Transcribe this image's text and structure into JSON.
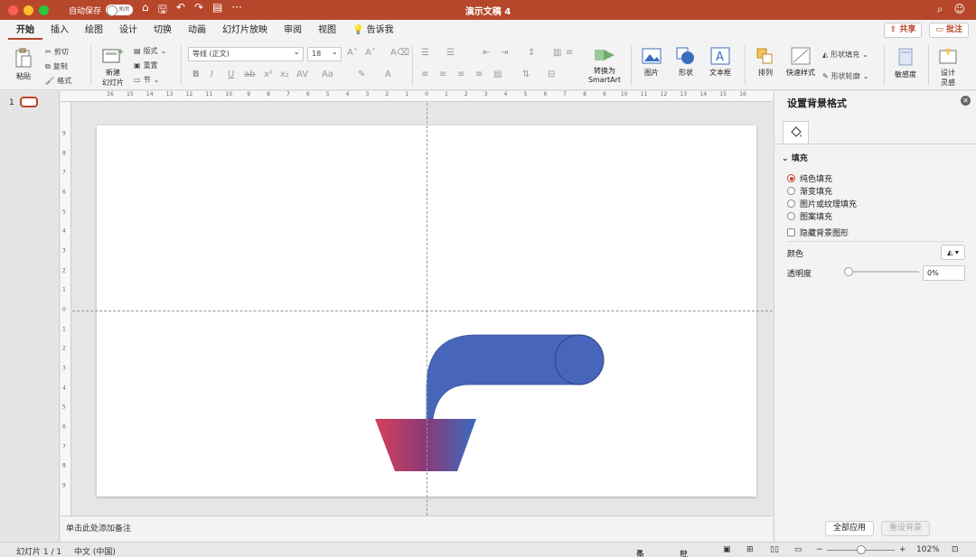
{
  "titlebar": {
    "autosave_label": "自动保存",
    "toggle_state": "关闭",
    "title": "演示文稿 4",
    "traffic_colors": [
      "#fe5f57",
      "#febc2e",
      "#28c840"
    ]
  },
  "tabs": {
    "items": [
      "开始",
      "插入",
      "绘图",
      "设计",
      "切换",
      "动画",
      "幻灯片放映",
      "审阅",
      "视图"
    ],
    "tell_me": "告诉我",
    "share": "共享",
    "comments": "批注",
    "active_index": 0
  },
  "ribbon": {
    "paste": "粘贴",
    "cut": "剪切",
    "copy": "复制",
    "format": "格式",
    "new_slide_line1": "新建",
    "new_slide_line2": "幻灯片",
    "layout": "版式",
    "reset": "重置",
    "section": "节",
    "font_name": "等线 (正文)",
    "font_size": "18",
    "convert_smartart_line1": "转换为",
    "convert_smartart_line2": "SmartArt",
    "picture": "图片",
    "shape": "形状",
    "textbox": "文本框",
    "arrange": "排列",
    "quick_styles": "快速样式",
    "shape_fill": "形状填充",
    "shape_outline": "形状轮廓",
    "sensitivity": "敏感度",
    "design_ideas_line1": "设计",
    "design_ideas_line2": "灵感"
  },
  "left": {
    "slide_number": "1"
  },
  "ruler": {
    "h_ticks": [
      "16",
      "15",
      "14",
      "13",
      "12",
      "11",
      "10",
      "9",
      "8",
      "7",
      "6",
      "5",
      "4",
      "3",
      "2",
      "1",
      "0",
      "1",
      "2",
      "3",
      "4",
      "5",
      "6",
      "7",
      "8",
      "9",
      "10",
      "11",
      "12",
      "13",
      "14",
      "15",
      "16"
    ],
    "v_ticks": [
      "9",
      "8",
      "7",
      "6",
      "5",
      "4",
      "3",
      "2",
      "1",
      "0",
      "1",
      "2",
      "3",
      "4",
      "5",
      "6",
      "7",
      "8",
      "9"
    ]
  },
  "notes": {
    "placeholder": "单击此处添加备注"
  },
  "format_pane": {
    "title": "设置背景格式",
    "section": "填充",
    "options": [
      "纯色填充",
      "渐变填充",
      "图片或纹理填充",
      "图案填充"
    ],
    "selected_option": 0,
    "hide_bg": "隐藏背景图形",
    "color_label": "颜色",
    "transparency_label": "透明度",
    "transparency_value": "0%",
    "apply_all": "全部应用",
    "reset_bg": "重设背景"
  },
  "statusbar": {
    "slide_info": "幻灯片 1 / 1",
    "language": "中文 (中国)",
    "notes": "备注",
    "comments": "批注",
    "zoom": "102%"
  },
  "shapes": {
    "pipe_color": "#4765bb",
    "bowl_gradient": [
      "#d5405a",
      "#8a3a78",
      "#3a6cc0"
    ]
  }
}
